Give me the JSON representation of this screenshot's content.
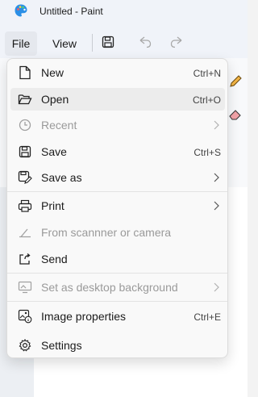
{
  "window": {
    "title": "Untitled - Paint"
  },
  "menubar": {
    "file": "File",
    "view": "View"
  },
  "toolbar": {
    "save_icon": "save-icon",
    "undo_icon": "undo-icon",
    "redo_icon": "redo-icon"
  },
  "file_menu": {
    "items": [
      {
        "label": "New",
        "shortcut": "Ctrl+N",
        "icon": "new-file-icon"
      },
      {
        "label": "Open",
        "shortcut": "Ctrl+O",
        "icon": "folder-open-icon",
        "selected": true
      },
      {
        "label": "Recent",
        "submenu": true,
        "disabled": true,
        "icon": "clock-icon"
      },
      {
        "label": "Save",
        "shortcut": "Ctrl+S",
        "icon": "save-icon"
      },
      {
        "label": "Save as",
        "submenu": true,
        "icon": "save-as-icon"
      },
      {
        "label": "Print",
        "submenu": true,
        "icon": "printer-icon"
      },
      {
        "label": "From scannner or camera",
        "disabled": true,
        "icon": "scanner-icon"
      },
      {
        "label": "Send",
        "icon": "share-icon"
      },
      {
        "label": "Set as desktop background",
        "submenu": true,
        "disabled": true,
        "icon": "desktop-background-icon"
      },
      {
        "label": "Image properties",
        "shortcut": "Ctrl+E",
        "icon": "image-properties-icon"
      },
      {
        "label": "Settings",
        "icon": "gear-icon"
      }
    ]
  },
  "colors": {
    "menu_bg": "#f9f9f9",
    "selected_bg": "#ececec",
    "disabled_text": "#9a9a9a",
    "file_active_bg": "#e5e8ee"
  }
}
